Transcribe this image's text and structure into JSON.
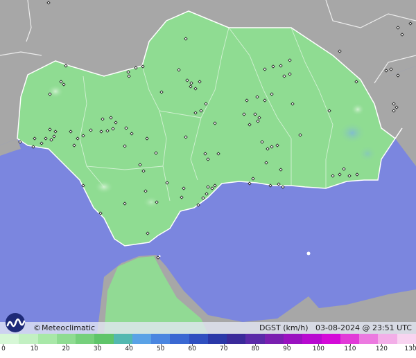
{
  "map": {
    "title": "DGST (km/h)",
    "date": "03-08-2024",
    "at": "@",
    "time": "23:51 UTC",
    "brand": "Meteoclimatic",
    "brand_symbol": "©",
    "colors": {
      "sea": "#7b86df",
      "land_outside": "#a9a9a9",
      "region_fill": "#8fdc92",
      "region_dark": "#7ccc80",
      "border": "#ffffff",
      "station": "#111111"
    }
  },
  "scale": {
    "unit": "km/h",
    "ticks": [
      "0",
      "10",
      "20",
      "30",
      "40",
      "50",
      "60",
      "70",
      "80",
      "90",
      "100",
      "110",
      "120",
      "130"
    ],
    "colors": [
      "#d6f7d6",
      "#c2f0c2",
      "#a8e8a8",
      "#8fdc92",
      "#76d07c",
      "#5fc56a",
      "#53b8b0",
      "#5aa2e6",
      "#4a86e0",
      "#3a68d2",
      "#2f4fc0",
      "#2a38a8",
      "#3a2a9a",
      "#5a2aa8",
      "#7a1fb0",
      "#9a12c0",
      "#b80ad0",
      "#d40ad8",
      "#e23ad8",
      "#ec7ae0",
      "#f3aee8",
      "#f8d4f0"
    ]
  }
}
